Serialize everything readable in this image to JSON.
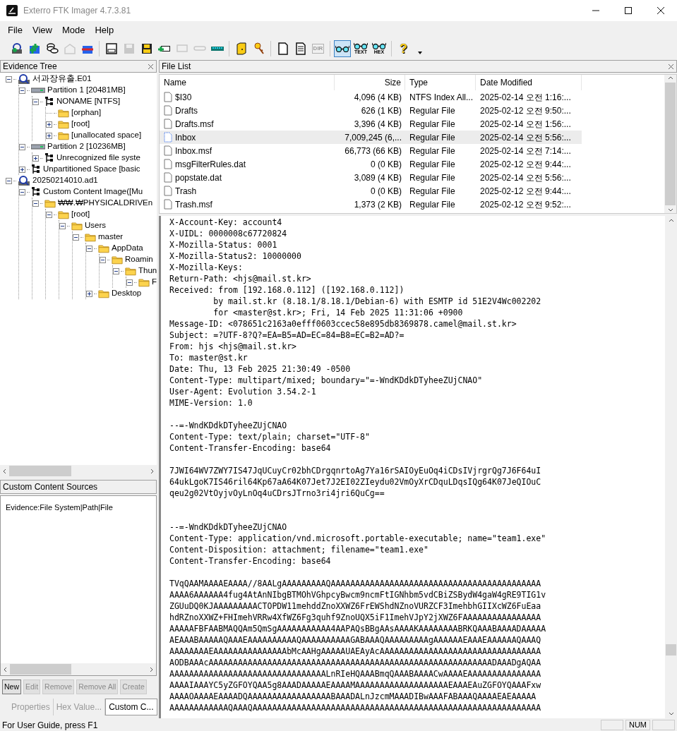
{
  "window": {
    "title": "Exterro FTK Imager 4.7.3.81"
  },
  "menu": [
    {
      "label": "File"
    },
    {
      "label": "View"
    },
    {
      "label": "Mode"
    },
    {
      "label": "Help"
    }
  ],
  "toolbar": [
    {
      "kind": "tool",
      "disabled": false
    },
    {
      "kind": "tool",
      "disabled": false
    },
    {
      "kind": "tool",
      "disabled": false
    },
    {
      "kind": "tool",
      "disabled": true
    },
    {
      "kind": "tool",
      "disabled": false
    },
    {
      "kind": "separator"
    },
    {
      "kind": "tool",
      "disabled": false
    },
    {
      "kind": "tool",
      "disabled": true
    },
    {
      "kind": "tool",
      "disabled": false
    },
    {
      "kind": "tool",
      "disabled": false
    },
    {
      "kind": "tool",
      "disabled": true
    },
    {
      "kind": "tool",
      "disabled": true
    },
    {
      "kind": "tool",
      "disabled": false
    },
    {
      "kind": "separator"
    },
    {
      "kind": "tool",
      "disabled": false
    },
    {
      "kind": "tool",
      "disabled": false
    },
    {
      "kind": "separator"
    },
    {
      "kind": "tool",
      "disabled": false
    },
    {
      "kind": "tool",
      "disabled": false
    },
    {
      "kind": "tool",
      "disabled": true,
      "label": "DIR"
    },
    {
      "kind": "separator"
    },
    {
      "kind": "viewer",
      "selected": true
    },
    {
      "kind": "viewer",
      "selected": false,
      "label": "TEXT"
    },
    {
      "kind": "viewer",
      "selected": false,
      "label": "HEX"
    },
    {
      "kind": "separator"
    },
    {
      "kind": "help",
      "label": "?"
    }
  ],
  "evidence_tree": {
    "title": "Evidence Tree",
    "items": [
      {
        "label": "서과장유출.E01",
        "kind": "evidence",
        "expanded": true,
        "children": [
          {
            "label": "Partition 1 [20481MB]",
            "kind": "partition",
            "expanded": true,
            "children": [
              {
                "label": "NONAME [NTFS]",
                "kind": "filesystem",
                "expanded": true,
                "children": [
                  {
                    "label": "[orphan]",
                    "kind": "folder"
                  },
                  {
                    "label": "[root]",
                    "kind": "folder",
                    "expanded": false
                  },
                  {
                    "label": "[unallocated space]",
                    "kind": "folder",
                    "expanded": false
                  }
                ]
              }
            ]
          },
          {
            "label": "Partition 2 [10236MB]",
            "kind": "partition",
            "expanded": true,
            "children": [
              {
                "label": "Unrecognized file syste",
                "kind": "filesystem",
                "expanded": false
              }
            ]
          },
          {
            "label": "Unpartitioned Space [basic",
            "kind": "filesystem",
            "expanded": false
          }
        ]
      },
      {
        "label": "20250214010.ad1",
        "kind": "evidence",
        "expanded": true,
        "children": [
          {
            "label": "Custom Content Image([Mu",
            "kind": "filesystem",
            "expanded": true,
            "children": [
              {
                "label": "₩₩.₩PHYSICALDRIVEn",
                "kind": "folder",
                "expanded": true,
                "children": [
                  {
                    "label": "[root]",
                    "kind": "folder",
                    "expanded": true,
                    "children": [
                      {
                        "label": "Users",
                        "kind": "folder",
                        "expanded": true,
                        "children": [
                          {
                            "label": "master",
                            "kind": "folder",
                            "expanded": true,
                            "children": [
                              {
                                "label": "AppData",
                                "kind": "folder",
                                "expanded": true,
                                "children": [
                                  {
                                    "label": "Roamin",
                                    "kind": "folder",
                                    "expanded": true,
                                    "children": [
                                      {
                                        "label": "Thun",
                                        "kind": "folder",
                                        "expanded": true,
                                        "children": [
                                          {
                                            "label": "F",
                                            "kind": "folder",
                                            "expanded": true
                                          }
                                        ]
                                      }
                                    ]
                                  }
                                ]
                              },
                              {
                                "label": "Desktop",
                                "kind": "folder",
                                "expanded": false
                              }
                            ]
                          }
                        ]
                      }
                    ]
                  }
                ]
              }
            ]
          }
        ]
      }
    ]
  },
  "custom_content_sources": {
    "title": "Custom Content Sources",
    "entries": [
      "Evidence:File System|Path|File"
    ],
    "buttons": [
      {
        "label": "New",
        "disabled": false
      },
      {
        "label": "Edit",
        "disabled": true
      },
      {
        "label": "Remove",
        "disabled": true
      },
      {
        "label": "Remove All",
        "disabled": true
      },
      {
        "label": "Create",
        "disabled": true
      }
    ]
  },
  "bottom_tabs": [
    {
      "label": "Properties",
      "selected": false
    },
    {
      "label": "Hex Value...",
      "selected": false
    },
    {
      "label": "Custom C...",
      "selected": true
    }
  ],
  "file_list": {
    "title": "File List",
    "columns": [
      "Name",
      "Size",
      "Type",
      "Date Modified"
    ],
    "rows": [
      {
        "name": "$I30",
        "size": "4,096 (4 KB)",
        "type": "NTFS Index All...",
        "modified": "2025-02-14 오전 1:16:...",
        "selected": false
      },
      {
        "name": "Drafts",
        "size": "626 (1 KB)",
        "type": "Regular File",
        "modified": "2025-02-12 오전 9:50:...",
        "selected": false
      },
      {
        "name": "Drafts.msf",
        "size": "3,396 (4 KB)",
        "type": "Regular File",
        "modified": "2025-02-14 오전 1:56:...",
        "selected": false
      },
      {
        "name": "Inbox",
        "size": "7,009,245 (6,...",
        "type": "Regular File",
        "modified": "2025-02-14 오전 5:56:...",
        "selected": true
      },
      {
        "name": "Inbox.msf",
        "size": "66,773 (66 KB)",
        "type": "Regular File",
        "modified": "2025-02-14 오전 7:14:...",
        "selected": false
      },
      {
        "name": "msgFilterRules.dat",
        "size": "0 (0 KB)",
        "type": "Regular File",
        "modified": "2025-02-12 오전 9:44:...",
        "selected": false
      },
      {
        "name": "popstate.dat",
        "size": "3,089 (4 KB)",
        "type": "Regular File",
        "modified": "2025-02-14 오전 5:56:...",
        "selected": false
      },
      {
        "name": "Trash",
        "size": "0 (0 KB)",
        "type": "Regular File",
        "modified": "2025-02-12 오전 9:44:...",
        "selected": false
      },
      {
        "name": "Trash.msf",
        "size": "1,373 (2 KB)",
        "type": "Regular File",
        "modified": "2025-02-12 오전 9:52:...",
        "selected": false
      }
    ]
  },
  "text_viewer": {
    "lines": [
      "X-Account-Key: account4",
      "X-UIDL: 0000008c67720824",
      "X-Mozilla-Status: 0001",
      "X-Mozilla-Status2: 10000000",
      "X-Mozilla-Keys:",
      "Return-Path: <hjs@mail.st.kr>",
      "Received: from [192.168.0.112] ([192.168.0.112])",
      "         by mail.st.kr (8.18.1/8.18.1/Debian-6) with ESMTP id 51E2V4Wc002202",
      "         for <master@st.kr>; Fri, 14 Feb 2025 11:31:06 +0900",
      "Message-ID: <078651c2163a0efff0603ccec58e895db8369878.camel@mail.st.kr>",
      "Subject: =?UTF-8?Q?=EA=B5=AD=EC=84=B8=EC=B2=AD?=",
      "From: hjs <hjs@mail.st.kr>",
      "To: master@st.kr",
      "Date: Thu, 13 Feb 2025 21:30:49 -0500",
      "Content-Type: multipart/mixed; boundary=\"=-WndKDdkDTyheeZUjCNAO\"",
      "User-Agent: Evolution 3.54.2-1",
      "MIME-Version: 1.0",
      {
        "kind": "blank"
      },
      "--=-WndKDdkDTyheeZUjCNAO",
      "Content-Type: text/plain; charset=\"UTF-8\"",
      "Content-Transfer-Encoding: base64",
      {
        "kind": "blank"
      },
      "7JWI64WV7ZWY7IS47JqUCuyCr02bhCDrgqnrtoAg7Ya16rSAIOyEuOq4iCDsIVjrgrQg7J6F64uI",
      "64ukLgoK7IS46ril64Kp67aA64K07Jet7J2EI02ZIeydu02VmOyXrCDquLDqsIQg64K07JeQIOuC",
      "qeu2g02VtOyjvOyLnOq4uCDrsJTrno3ri4jri6QuCg==",
      {
        "kind": "blank"
      },
      {
        "kind": "blank"
      },
      "--=-WndKDdkDTyheeZUjCNAO",
      "Content-Type: application/vnd.microsoft.portable-executable; name=\"team1.exe\"",
      "Content-Disposition: attachment; filename=\"team1.exe\"",
      "Content-Transfer-Encoding: base64",
      {
        "kind": "blank"
      },
      "TVqQAAMAAAAEAAAA//8AALgAAAAAAAAAQAAAAAAAAAAAAAAAAAAAAAAAAAAAAAAAAAAAAAAAAAAA",
      "AAAA6AAAAAA4fug4AtAnNIbgBTMOhVGhpcyBwcm9ncmFtIGNhbm5vdCBiZSBydW4gaW4gRE9TIG1v",
      "ZGUuDQ0KJAAAAAAAAACTOPDW11mehddZnoXXWZ6FrEWShdNZnoVURZCF3ImehbhGIIXcWZ6FuEaa",
      "hdRZnoXXWZ+FHImehVRRw4XfWZ6Fg3quhf9ZnoUQX5iF1ImehVJpY2jXWZ6FAAAAAAAAAAAAAAAA",
      "AAAAAFBFAABMAQQAm5QmSgAAAAAAAAAAA4AAPAQsBBgAAsAAAAKAAAAAAAABRKQAAABAAAADAAAAA",
      "AEAAABAAAAAQAAAEAAAAAAAAAAQAAAAAAAAAAGABAAAQAAAAAAAAAgAAAAAAEAAAEAAAAAAQAAAQ",
      "AAAAAAAAEAAAAAAAAAAAAAAAbMcAAHgAAAAAUAEAyAcAAAAAAAAAAAAAAAAAAAAAAAAAAAAAAAAA",
      "AODBAAAcAAAAAAAAAAAAAAAAAAAAAAAAAAAAAAAAAAAAAAAAAAAAAAAAAAAAAAAAAADAAADgAQAA",
      "AAAAAAAAAAAAAAAAAAAAAAAAAAAAAAAALnRIeHQAAABmqQAAABAAAACwAAAAEAAAAAAAAAAAAAAA",
      "AAAAIAAAYC5yZGFOYQAA5g8AAADAAAAAEAAAAMAAAAAAAAAAAAAAAAAAAEAAAEAuZGFOYQAAAFxw",
      "AAAAOAAAAEAAAADQAAAAAAAAAAAAAAAAABAAADALnJzcmMAAADIBwAAAFABAAAQAAAAEAEAAAAA",
      "AAAAAAAAAAAAQAAAQAAAAAAAAAAAAAAAAAAAAAAAAAAAAAAAAAAAAAAAAAAAAAAAAAAAAAAAAAAA"
    ]
  },
  "status_bar": {
    "text": "For User Guide, press F1",
    "indicators": [
      "NUM"
    ]
  }
}
